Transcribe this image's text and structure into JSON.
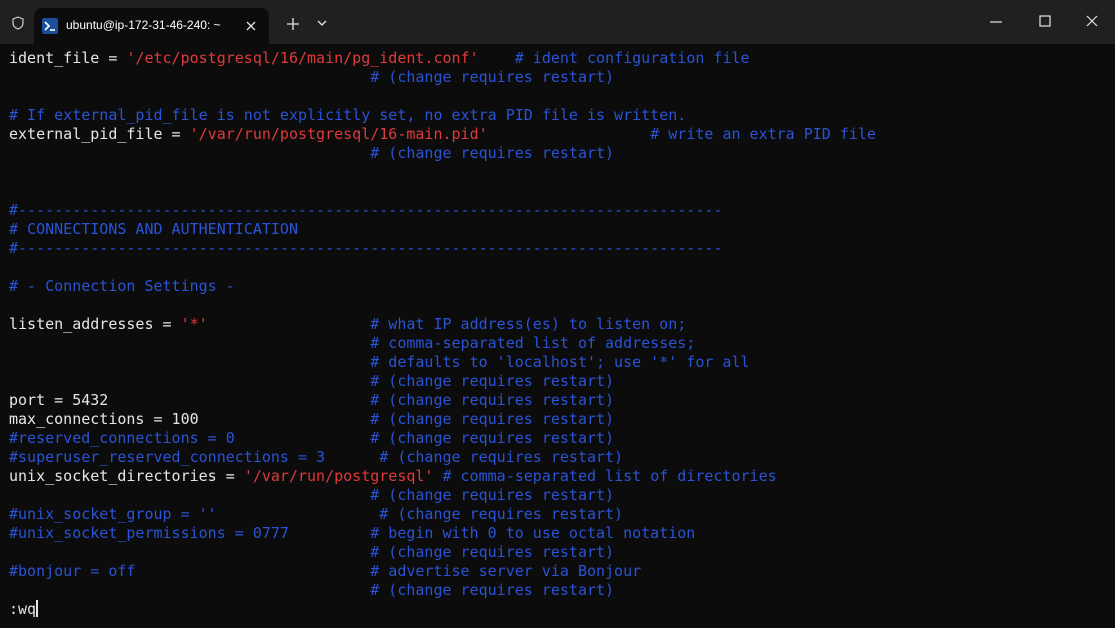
{
  "window": {
    "tab_title": "ubuntu@ip-172-31-46-240: ~",
    "tab_icon": "powershell-icon"
  },
  "terminal": {
    "l1_key": "ident_file = ",
    "l1_val": "'/etc/postgresql/16/main/pg_ident.conf'",
    "l1_comment": "    # ident configuration file",
    "l2_comment": "                                        # (change requires restart)",
    "l4_comment": "# If external_pid_file is not explicitly set, no extra PID file is written.",
    "l5_key": "external_pid_file = ",
    "l5_val": "'/var/run/postgresql/16-main.pid'",
    "l5_comment": "                  # write an extra PID file",
    "l6_comment": "                                        # (change requires restart)",
    "l9_comment": "#------------------------------------------------------------------------------",
    "l10_comment": "# CONNECTIONS AND AUTHENTICATION",
    "l11_comment": "#------------------------------------------------------------------------------",
    "l13_comment": "# - Connection Settings -",
    "l15_key": "listen_addresses = ",
    "l15_val": "'*'",
    "l15_comment": "                  # what IP address(es) to listen on;",
    "l16_comment": "                                        # comma-separated list of addresses;",
    "l17_comment": "                                        # defaults to 'localhost'; use '*' for all",
    "l18_comment": "                                        # (change requires restart)",
    "l19_key": "port = 5432",
    "l19_comment": "                             # (change requires restart)",
    "l20_key": "max_connections = 100",
    "l20_comment": "                   # (change requires restart)",
    "l21_comment": "#reserved_connections = 0               # (change requires restart)",
    "l22_comment": "#superuser_reserved_connections = 3      # (change requires restart)",
    "l23_key": "unix_socket_directories = ",
    "l23_val": "'/var/run/postgresql'",
    "l23_comment": " # comma-separated list of directories",
    "l24_comment": "                                        # (change requires restart)",
    "l25_comment": "#unix_socket_group = ''                  # (change requires restart)",
    "l26_comment": "#unix_socket_permissions = 0777         # begin with 0 to use octal notation",
    "l27_comment": "                                        # (change requires restart)",
    "l28_comment": "#bonjour = off                          # advertise server via Bonjour",
    "l29_comment": "                                        # (change requires restart)",
    "command": ":wq"
  }
}
